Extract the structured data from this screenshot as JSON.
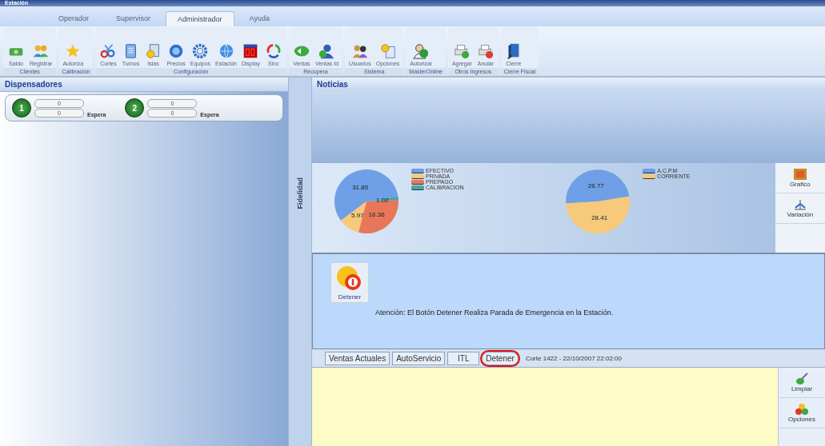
{
  "window": {
    "title": "Estación"
  },
  "tabs": [
    {
      "label": "Operador",
      "selected": false
    },
    {
      "label": "Supervisor",
      "selected": false
    },
    {
      "label": "Administrador",
      "selected": true
    },
    {
      "label": "Ayuda",
      "selected": false
    }
  ],
  "ribbon": [
    {
      "group": "Clientes",
      "buttons": [
        "Saldo",
        "Registrar"
      ]
    },
    {
      "group": "Calibración",
      "buttons": [
        "Autoriza"
      ]
    },
    {
      "group": "Configuración",
      "buttons": [
        "Cortes",
        "Turnos",
        "Islas",
        "Precios",
        "Equipos",
        "Estación",
        "Display",
        "Sinc"
      ]
    },
    {
      "group": "Recupera",
      "buttons": [
        "Ventas",
        "Ventas Id"
      ]
    },
    {
      "group": "Sistema",
      "buttons": [
        "Usuarios",
        "Opciones"
      ]
    },
    {
      "group": "MasterOnline",
      "buttons": [
        "Autorizar"
      ]
    },
    {
      "group": "Otros Ingresos",
      "buttons": [
        "Agregar",
        "Anular"
      ]
    },
    {
      "group": "Cierre Fiscal",
      "buttons": [
        "Cierre"
      ]
    }
  ],
  "dispensers": {
    "title": "Dispensadores",
    "items": [
      {
        "number": "1",
        "values": [
          "0",
          "0"
        ],
        "status": "Espera"
      },
      {
        "number": "2",
        "values": [
          "0",
          "0"
        ],
        "status": "Espera"
      }
    ]
  },
  "side_tab": "Fidelidad",
  "news": {
    "title": "Noticias",
    "charts": [
      {
        "chart_data": {
          "type": "pie",
          "categories": [
            "EFECTIVO",
            "PRIVADA",
            "PREPAGO",
            "CALIBRACION"
          ],
          "series": [
            {
              "values": [
                31.85,
                5.97,
                16.36,
                1.02
              ]
            }
          ],
          "colors": [
            "#6f9fe6",
            "#f7c97a",
            "#e8775a",
            "#4aa3a8"
          ],
          "data_labels": true
        }
      },
      {
        "chart_data": {
          "type": "pie",
          "categories": [
            "A.C.P.M",
            "CORRIENTE"
          ],
          "series": [
            {
              "values": [
                26.77,
                28.41
              ]
            }
          ],
          "colors": [
            "#6f9fe6",
            "#f7c97a"
          ],
          "data_labels": true
        }
      }
    ],
    "side_buttons": [
      "Grafico",
      "Variación"
    ]
  },
  "alert": {
    "button": "Detener",
    "message": "Atención: El Botón Detener Realiza Parada de Emergencia en la Estación."
  },
  "bottom_tabs": [
    {
      "label": "Ventas Actuales",
      "selected": false,
      "circled": false
    },
    {
      "label": "AutoServicio",
      "selected": false,
      "circled": false
    },
    {
      "label": "ITL",
      "selected": false,
      "circled": false
    },
    {
      "label": "Detener",
      "selected": false,
      "circled": true
    }
  ],
  "status": "Corte 1422 - 22/10/2007 22:02:00",
  "log_buttons": [
    "Limpiar",
    "Opciones"
  ]
}
